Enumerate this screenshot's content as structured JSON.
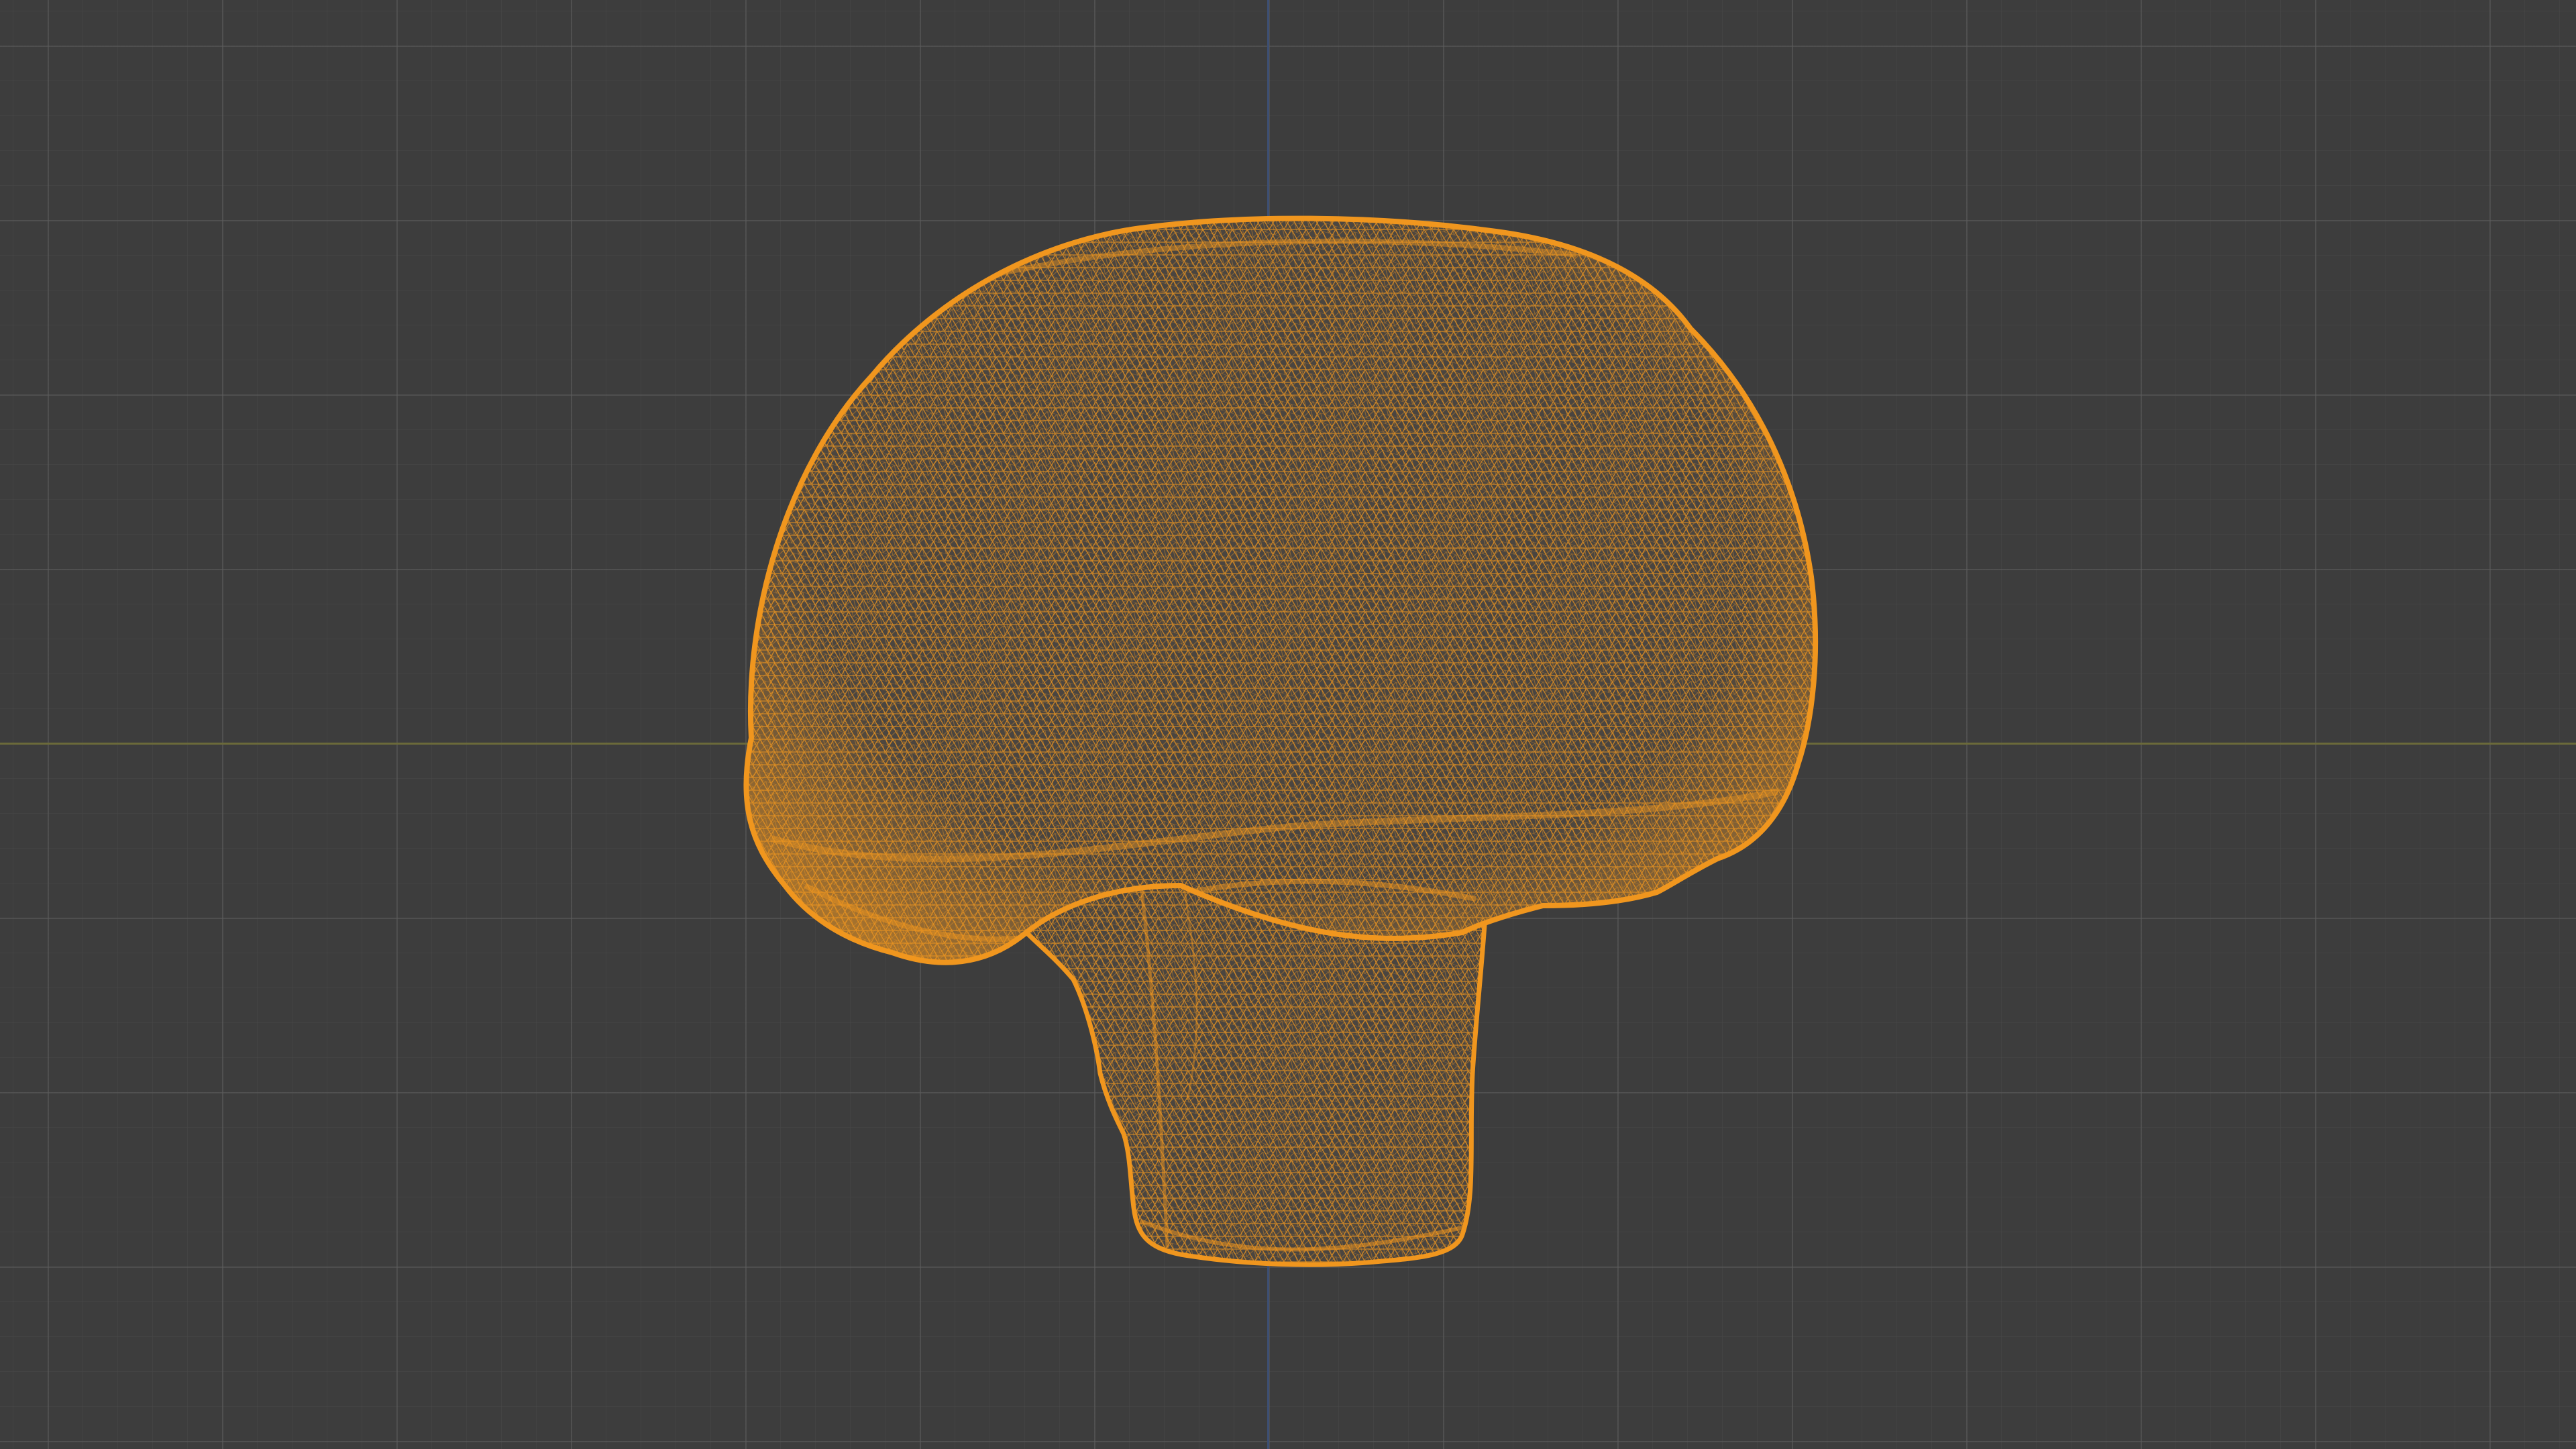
{
  "viewport": {
    "mode": "wireframe",
    "object": "mushroom-mesh",
    "background_color": "#3d3d3d",
    "grid_color": "#4a4a4a",
    "x_axis_color": "#6b6a3a",
    "y_axis_color": "#3d4f73",
    "wire_color": "#f0961e"
  }
}
